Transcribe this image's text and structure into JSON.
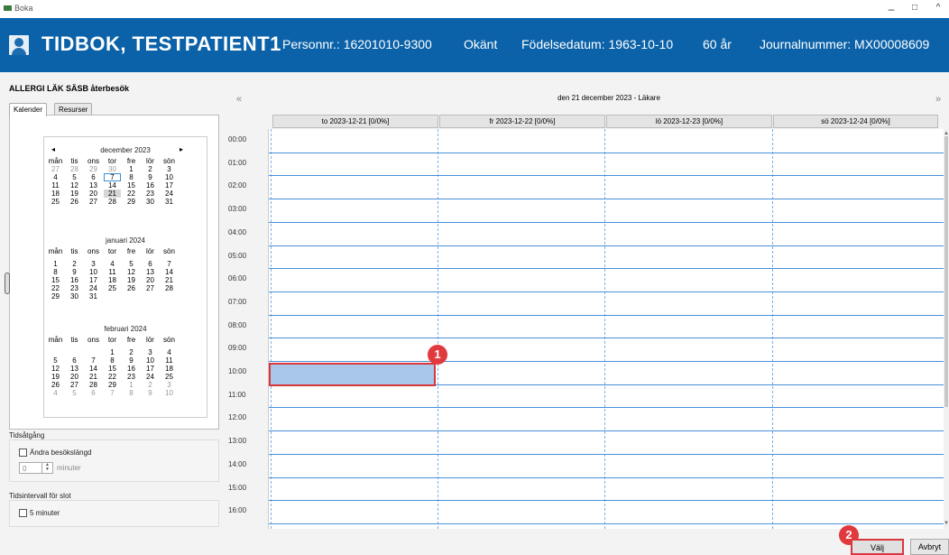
{
  "window": {
    "title": "Boka"
  },
  "header": {
    "patient_name": "TIDBOK, TESTPATIENT1",
    "personnr": "Personnr.: 16201010-9300",
    "gender": "Okänt",
    "birthdate": "Födelsedatum: 1963-10-10",
    "age": "60 år",
    "journal": "Journalnummer: MX00008609"
  },
  "panel": {
    "title": "ALLERGI LÄK SÄSB återbesök",
    "tabs": [
      "Kalender",
      "Resurser"
    ]
  },
  "calendar": {
    "prev": "◂",
    "next": "▸",
    "weekdays": [
      "mån",
      "tis",
      "ons",
      "tor",
      "fre",
      "lör",
      "sön"
    ],
    "months": [
      {
        "name": "december 2023",
        "weeks": [
          [
            "27",
            "28",
            "29",
            "30",
            "1",
            "2",
            "3"
          ],
          [
            "4",
            "5",
            "6",
            "7",
            "8",
            "9",
            "10"
          ],
          [
            "11",
            "12",
            "13",
            "14",
            "15",
            "16",
            "17"
          ],
          [
            "18",
            "19",
            "20",
            "21",
            "22",
            "23",
            "24"
          ],
          [
            "25",
            "26",
            "27",
            "28",
            "29",
            "30",
            "31"
          ]
        ]
      },
      {
        "name": "januari 2024",
        "weeks": [
          [
            "1",
            "2",
            "3",
            "4",
            "5",
            "6",
            "7"
          ],
          [
            "8",
            "9",
            "10",
            "11",
            "12",
            "13",
            "14"
          ],
          [
            "15",
            "16",
            "17",
            "18",
            "19",
            "20",
            "21"
          ],
          [
            "22",
            "23",
            "24",
            "25",
            "26",
            "27",
            "28"
          ],
          [
            "29",
            "30",
            "31",
            "",
            "",
            "",
            ""
          ]
        ]
      },
      {
        "name": "februari 2024",
        "weeks": [
          [
            "",
            "",
            "",
            "1",
            "2",
            "3",
            "4"
          ],
          [
            "5",
            "6",
            "7",
            "8",
            "9",
            "10",
            "11"
          ],
          [
            "12",
            "13",
            "14",
            "15",
            "16",
            "17",
            "18"
          ],
          [
            "19",
            "20",
            "21",
            "22",
            "23",
            "24",
            "25"
          ],
          [
            "26",
            "27",
            "28",
            "29",
            "1",
            "2",
            "3"
          ],
          [
            "4",
            "5",
            "6",
            "7",
            "8",
            "9",
            "10"
          ]
        ]
      }
    ]
  },
  "tidsatgang": {
    "label": "Tidsåtgång",
    "checkbox_label": "Ändra besökslängd",
    "value": "0",
    "unit": "minuter"
  },
  "tidsintervall": {
    "label": "Tidsintervall för slot",
    "checkbox_label": "5 minuter"
  },
  "schedule": {
    "title": "den 21 december 2023 - Läkare",
    "prev": "«",
    "next": "»",
    "columns": [
      "to 2023-12-21  [0/0%]",
      "fr 2023-12-22  [0/0%]",
      "lö 2023-12-23  [0/0%]",
      "sö 2023-12-24  [0/0%]"
    ],
    "times": [
      "00:00",
      "01:00",
      "02:00",
      "03:00",
      "04:00",
      "05:00",
      "06:00",
      "07:00",
      "08:00",
      "09:00",
      "10:00",
      "11:00",
      "12:00",
      "13:00",
      "14:00",
      "15:00",
      "16:00"
    ]
  },
  "markers": [
    "1",
    "2"
  ],
  "buttons": {
    "choose": "Välj",
    "cancel": "Avbryt"
  }
}
